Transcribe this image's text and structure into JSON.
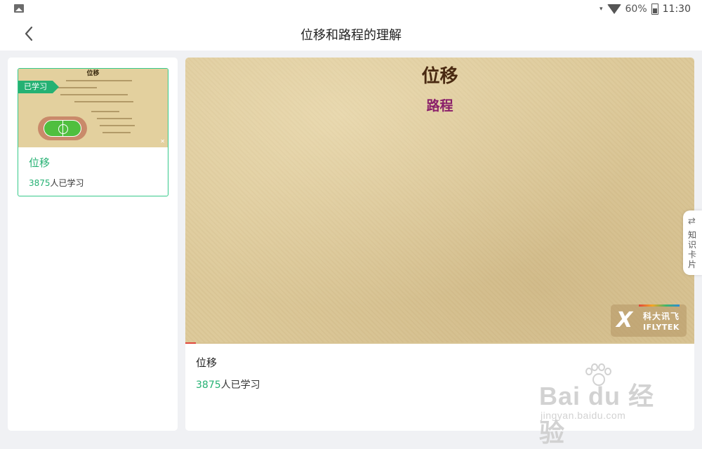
{
  "status_bar": {
    "battery": "60%",
    "time": "11:30"
  },
  "header": {
    "title": "位移和路程的理解"
  },
  "lesson_list": {
    "items": [
      {
        "badge": "已学习",
        "thumb_title": "位移",
        "name": "位移",
        "count": "3875",
        "count_suffix": "人已学习"
      }
    ]
  },
  "player": {
    "title": "位移",
    "subtitle": "路程",
    "logo_cn": "科大讯飞",
    "logo_en": "IFLYTEK",
    "progress": 0.02
  },
  "details": {
    "name": "位移",
    "count": "3875",
    "count_suffix": "人已学习"
  },
  "side_tab": {
    "label": "知识卡片"
  },
  "watermark": {
    "text": "Bai du 经验",
    "url": "jingyan.baidu.com"
  }
}
